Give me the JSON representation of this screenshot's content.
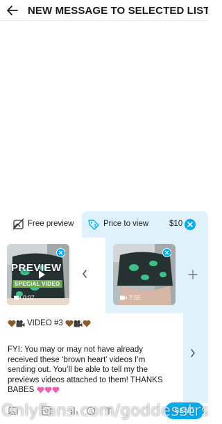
{
  "header": {
    "title": "NEW MESSAGE TO SELECTED LIST"
  },
  "tabs": {
    "free_label": "Free preview",
    "price_label": "Price to view",
    "price_value": "$10"
  },
  "media": [
    {
      "overlay_title": "PREVIEW",
      "overlay_tag": "SPECIAL VIDEO",
      "duration": "0:07"
    },
    {
      "duration": "7:55"
    }
  ],
  "message": {
    "title_text": "VIDEO #3",
    "body": "FYI: You may or may not have already received these ‘brown heart’ videos I’m sending out. You’ll be able to tell my the previews videos attached to them! THANKS BABES"
  },
  "footer": {
    "send_label": "SEND"
  },
  "watermark": "OnlyFans.com/goddesstrs",
  "colors": {
    "accent": "#00aeef",
    "selected_tab_bg": "#dff2fb",
    "special_tag_bg": "#6aa84f",
    "heart_brown": "#8b5a2b",
    "heart_pink": "#f25fb0"
  },
  "icons": [
    "back-arrow-icon",
    "free-preview-icon",
    "price-tag-icon",
    "clear-icon",
    "remove-media-icon",
    "video-camera-icon",
    "chevron-left-icon",
    "plus-icon",
    "chevron-right-icon",
    "brown-heart-emoji",
    "video-camera-emoji",
    "pink-hearts-emoji",
    "media-icon",
    "vault-icon",
    "poll-icon",
    "clock-icon",
    "text-icon"
  ]
}
